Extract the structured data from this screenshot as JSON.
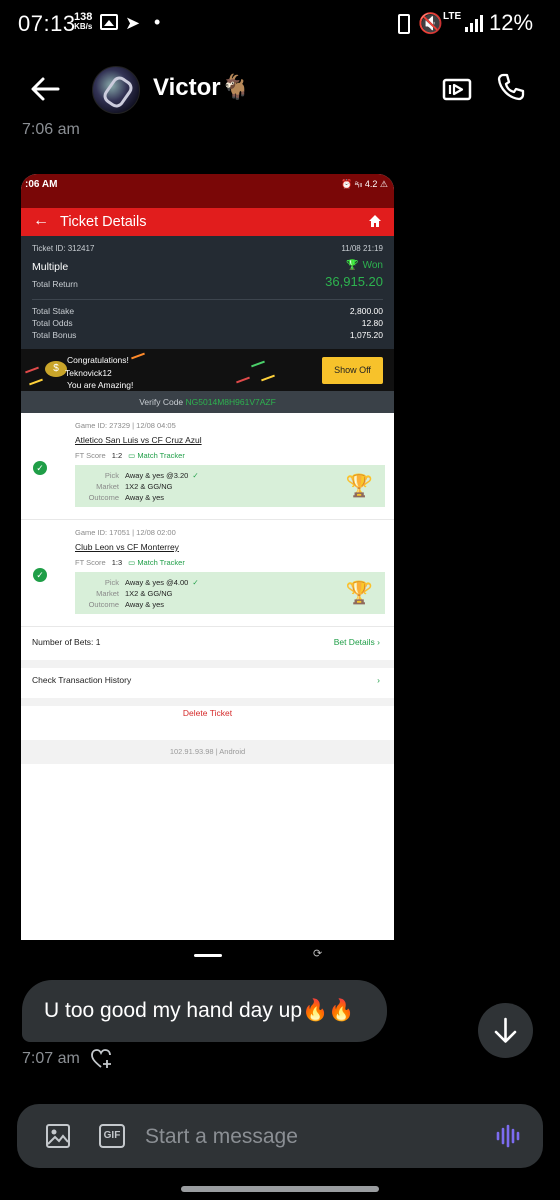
{
  "status_bar": {
    "time": "07:13",
    "speed_value": "138",
    "speed_unit": "KB/s",
    "network": "LTE",
    "battery": "12%"
  },
  "header": {
    "contact_name": "Victor🐐"
  },
  "messages": {
    "top_time": "7:06 am",
    "bubble_text": "U too good my hand day up🔥🔥",
    "bubble_time": "7:07 am"
  },
  "screenshot": {
    "status_time": ":06 AM",
    "status_right": "⏰ ᵃᵢₗₗ 4.2 ⚠",
    "title": "Ticket Details",
    "ticket": {
      "ticket_id": "Ticket ID: 312417",
      "date": "11/08 21:19",
      "type": "Multiple",
      "status": "Won",
      "total_return_label": "Total Return",
      "total_return": "36,915.20",
      "total_stake_label": "Total Stake",
      "total_stake": "2,800.00",
      "total_odds_label": "Total Odds",
      "total_odds": "12.80",
      "total_bonus_label": "Total Bonus",
      "total_bonus": "1,075.20"
    },
    "promo": {
      "line1": "Congratulations!",
      "line2": "Teknovick12",
      "line3": "You are Amazing!",
      "button": "Show Off"
    },
    "verify_label": "Verify Code",
    "verify_code": "NG5014M8H961V7AZF",
    "games": [
      {
        "game_id": "Game ID: 27329 | 12/08 04:05",
        "match": "Atletico San Luis vs CF Cruz Azul",
        "ft_label": "FT Score",
        "ft_score": "1:2",
        "tracker": "Match Tracker",
        "pick": "Away & yes @3.20",
        "market": "1X2 & GG/NG",
        "outcome": "Away & yes"
      },
      {
        "game_id": "Game ID: 17051 | 12/08 02:00",
        "match": "Club Leon vs CF Monterrey",
        "ft_label": "FT Score",
        "ft_score": "1:3",
        "tracker": "Match Tracker",
        "pick": "Away & yes @4.00",
        "market": "1X2 & GG/NG",
        "outcome": "Away & yes"
      }
    ],
    "labels": {
      "pick": "Pick",
      "market": "Market",
      "outcome": "Outcome"
    },
    "number_of_bets": "Number of Bets: 1",
    "bet_details": "Bet Details",
    "check_history": "Check Transaction History",
    "delete_ticket": "Delete Ticket",
    "version": "102.91.93.98 | Android"
  },
  "composer": {
    "placeholder": "Start a message",
    "gif_label": "GIF"
  },
  "colors": {
    "accent_red": "#e11d1d",
    "won_green": "#2db34f",
    "bubble_bg": "#2f3336",
    "voice_purple": "#7c6cf0"
  }
}
